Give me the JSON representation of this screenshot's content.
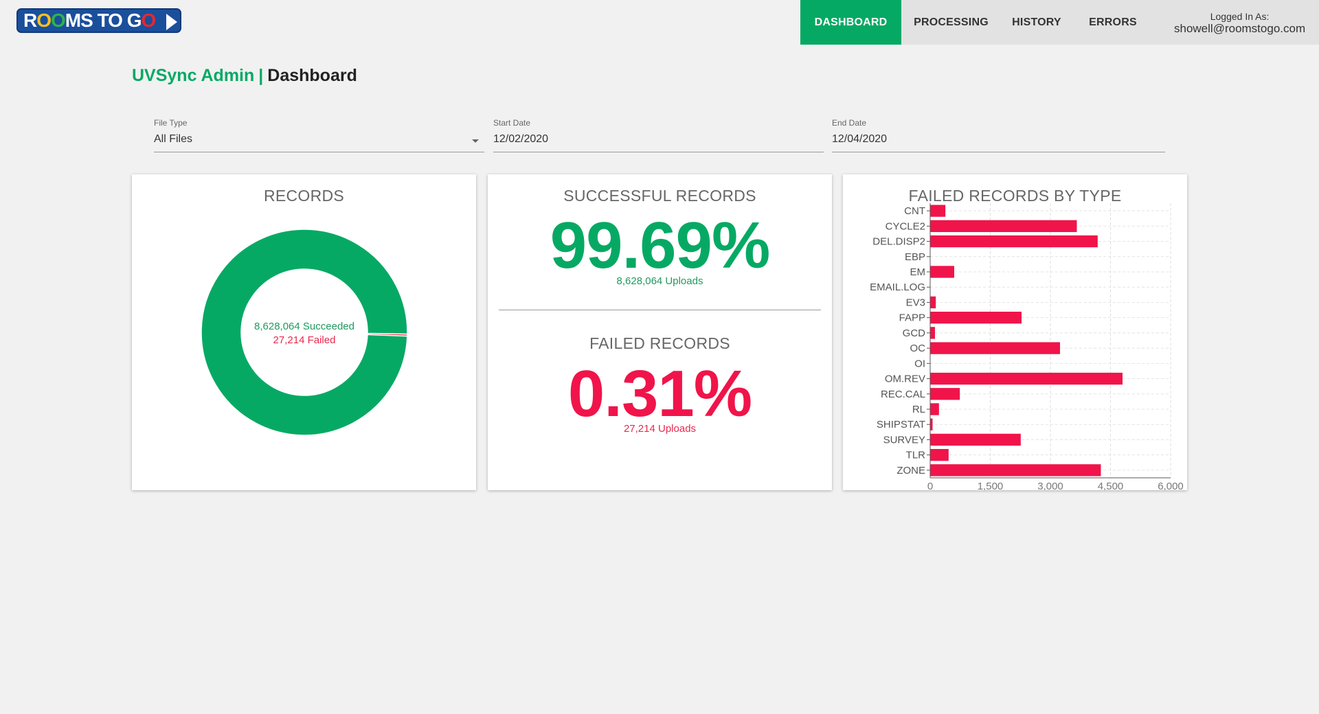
{
  "brand": {
    "logo_text_parts": [
      "R",
      "O",
      "O",
      "MS TO G",
      "O"
    ],
    "logo_alt": "ROOMS TO GO"
  },
  "nav": {
    "tabs": [
      "DASHBOARD",
      "PROCESSING",
      "HISTORY",
      "ERRORS"
    ],
    "active": "DASHBOARD",
    "login_label": "Logged In As:",
    "login_email": "showell@roomstogo.com"
  },
  "header": {
    "app_name": "UVSync Admin",
    "separator": "|",
    "section": "Dashboard"
  },
  "filters": {
    "file_type_label": "File Type",
    "file_type_value": "All Files",
    "start_date_label": "Start Date",
    "start_date_value": "12/02/2020",
    "end_date_label": "End Date",
    "end_date_value": "12/04/2020"
  },
  "records_card": {
    "title": "RECORDS",
    "succeeded_text": "8,628,064 Succeeded",
    "failed_text": "27,214 Failed"
  },
  "success_card": {
    "success_title": "SUCCESSFUL RECORDS",
    "success_pct": "99.69%",
    "success_uploads": "8,628,064 Uploads",
    "failed_title": "FAILED RECORDS",
    "failed_pct": "0.31%",
    "failed_uploads": "27,214 Uploads"
  },
  "colors": {
    "accent": "#06a964",
    "failed": "#f0144a",
    "nav_bg": "#e2e2e2",
    "page_bg": "#f1f1f1",
    "brand_blue": "#1a4f9c"
  },
  "chart_data": [
    {
      "type": "pie",
      "title": "RECORDS",
      "labels": [
        "Succeeded",
        "Failed"
      ],
      "values": [
        8628064,
        27214
      ],
      "colors": [
        "#06a964",
        "#e8284e"
      ],
      "donut": true
    },
    {
      "type": "bar",
      "orientation": "horizontal",
      "title": "FAILED RECORDS BY TYPE",
      "categories": [
        "CNT",
        "CYCLE2",
        "DEL.DISP2",
        "EBP",
        "EM",
        "EMAIL.LOG",
        "EV3",
        "FAPP",
        "GCD",
        "OC",
        "OI",
        "OM.REV",
        "REC.CAL",
        "RL",
        "SHIPSTAT",
        "SURVEY",
        "TLR",
        "ZONE"
      ],
      "values": [
        380,
        3660,
        4180,
        0,
        600,
        0,
        140,
        2280,
        120,
        3240,
        0,
        4800,
        740,
        220,
        60,
        2260,
        460,
        4260
      ],
      "xlim": [
        0,
        6000
      ],
      "xticks": [
        "0",
        "1,500",
        "3,000",
        "4,500",
        "6,000"
      ],
      "color": "#f0144a",
      "grid": true
    }
  ]
}
